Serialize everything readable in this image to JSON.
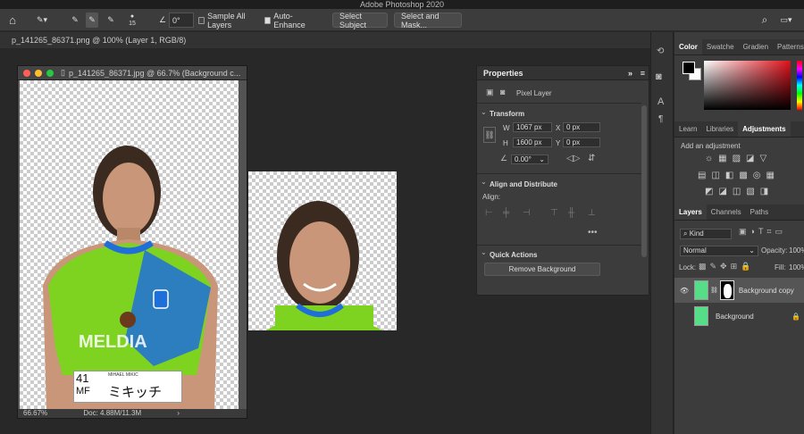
{
  "app_title": "Adobe Photoshop 2020",
  "options_bar": {
    "brush_size": "15",
    "angle": "0°",
    "sample_all_layers": "Sample All Layers",
    "auto_enhance": "Auto-Enhance",
    "select_subject": "Select Subject",
    "select_and_mask": "Select and Mask..."
  },
  "doc_tab": "p_141265_86371.png @ 100% (Layer 1, RGB/8)",
  "doc_window": {
    "title": "p_141265_86371.jpg @ 66.7% (Background c...",
    "zoom": "66.67%",
    "doc_size": "Doc: 4.88M/11.3M",
    "bib_number": "41",
    "bib_pos": "MF",
    "bib_name_small": "MIHAEL MIKIC",
    "bib_name": "ミキッチ",
    "shirt_text": "MELDIA"
  },
  "properties": {
    "tab": "Properties",
    "layer_type": "Pixel Layer",
    "transform": "Transform",
    "w_label": "W",
    "w_value": "1067 px",
    "h_label": "H",
    "h_value": "1600 px",
    "x_label": "X",
    "x_value": "0 px",
    "y_label": "Y",
    "y_value": "0 px",
    "angle_value": "0.00°",
    "align_distribute": "Align and Distribute",
    "align_label": "Align:",
    "quick_actions": "Quick Actions",
    "remove_bg": "Remove Background"
  },
  "color_panel": {
    "tabs": [
      "Color",
      "Swatche",
      "Gradien",
      "Patterns"
    ]
  },
  "learn_panel": {
    "tabs": [
      "Learn",
      "Libraries",
      "Adjustments"
    ],
    "add_adjustment": "Add an adjustment"
  },
  "layers_panel": {
    "tabs": [
      "Layers",
      "Channels",
      "Paths"
    ],
    "kind": "Kind",
    "blend": "Normal",
    "opacity_label": "Opacity:",
    "opacity_value": "100%",
    "lock_label": "Lock:",
    "fill_label": "Fill:",
    "fill_value": "100%",
    "layers": [
      {
        "name": "Background copy"
      },
      {
        "name": "Background"
      }
    ]
  },
  "colors": {
    "accent": "#2d7dd2",
    "shirt": "#7ed321",
    "stripe": "#1e6fd9"
  }
}
